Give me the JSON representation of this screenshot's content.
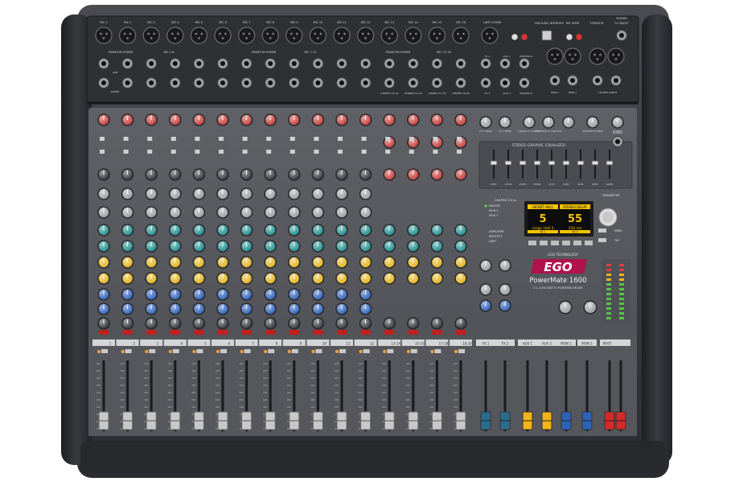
{
  "brand": {
    "top_text": "EGO TECHNOLOGY",
    "logo": "EGO",
    "model": "PowerMate 1600",
    "subtitle": "2 x 1000 WATTS POWERED MIXER"
  },
  "channels": {
    "strip_count": 16,
    "mono_labels": [
      "1",
      "2",
      "3",
      "4",
      "5",
      "6",
      "7",
      "8",
      "9",
      "10",
      "11",
      "12"
    ],
    "stereo_labels": [
      "13-14",
      "15-16",
      "17-18",
      "19-20"
    ],
    "rear_labels": [
      "MIC 1",
      "MIC 2",
      "MIC 3",
      "MIC 4",
      "MIC 5",
      "MIC 6",
      "MIC 7",
      "MIC 8",
      "MIC 9",
      "MIC 10",
      "MIC 11",
      "MIC 12",
      "MIC 13",
      "MIC 14",
      "MIC 15",
      "MIC 16"
    ]
  },
  "rear_panel": {
    "phantom_labels": [
      "PHANTOM POWER",
      "PHANTOM POWER",
      "PHANTOM POWER"
    ],
    "phantom_ranges": [
      "MIC 1-6",
      "MIC 7-12",
      "MIC 13-16"
    ],
    "input_labels": [
      "LINE",
      "INSERT"
    ],
    "stereo_labels": [
      "STEREO 13-14",
      "STEREO 15-16",
      "STEREO 17-18",
      "STEREO 19-20"
    ],
    "right_labels": [
      "LAMP 12V/5W",
      "USB AUDIO INTERFACE",
      "REC SEND",
      "2TRACK IN",
      "FX ON/OFF",
      "PHONES"
    ],
    "output_labels": [
      "FX 1",
      "AUX 1",
      "MASTER R",
      "FX 2",
      "AUX 2",
      "MASTER R",
      "MON 1",
      "MON 2",
      "L POWER AMP R"
    ]
  },
  "master": {
    "section_labels": [
      "FX 1 SEND",
      "FX 2 SEND",
      "2TRACK to MASTER",
      "REC SEND & USB OUT",
      "MASTER PHONES",
      "PHONES"
    ],
    "eq_title": "STEREO GRAPHIC EQUALIZER",
    "eq_band_count": 9,
    "eq_freqs": [
      "63Hz",
      "125Hz",
      "250Hz",
      "500Hz",
      "1kHz",
      "2kHz",
      "4kHz",
      "8kHz",
      "16kHz"
    ],
    "graphic_eq_label": "GRAPHIC EQ to",
    "graphic_eq_options": [
      "MASTER",
      "MON 1",
      "MON 2"
    ],
    "amp_label": [
      "AMPLIFIER",
      "PROTECT",
      "LIMIT"
    ],
    "parameter_label": "PARAMETER",
    "menu_label": "MENU",
    "tap_label": "TAP"
  },
  "fx_display": {
    "fx1_title": "HICKET HALL",
    "fx2_title": "STEREO DELAY",
    "fx1_number": "5",
    "fx2_number": "55",
    "fx1_name": "Large Hall 3",
    "fx2_value": "250 ms",
    "fx1_tag": "FX 1",
    "fx2_tag": "FX 2"
  },
  "bottom": {
    "group_labels": [
      "FX 1",
      "FX 2",
      "AUX 1",
      "AUX 2",
      "MON 1",
      "MON 2",
      "MASTER"
    ],
    "fader_cap_colors": {
      "channel": "#c8c8c8",
      "fx": "#2a6e8f",
      "aux": "#f2b418",
      "mon": "#2c63b8",
      "master": "#d52a2a"
    }
  },
  "colors": {
    "body": "#3d3e42",
    "panel": "#595b60",
    "knob_red": "#c33a35",
    "knob_teal": "#1e8c8c",
    "knob_yellow": "#e1b21a",
    "knob_blue": "#2a5db8",
    "knob_grey": "#9a9ca0",
    "display": "#f5c300"
  }
}
